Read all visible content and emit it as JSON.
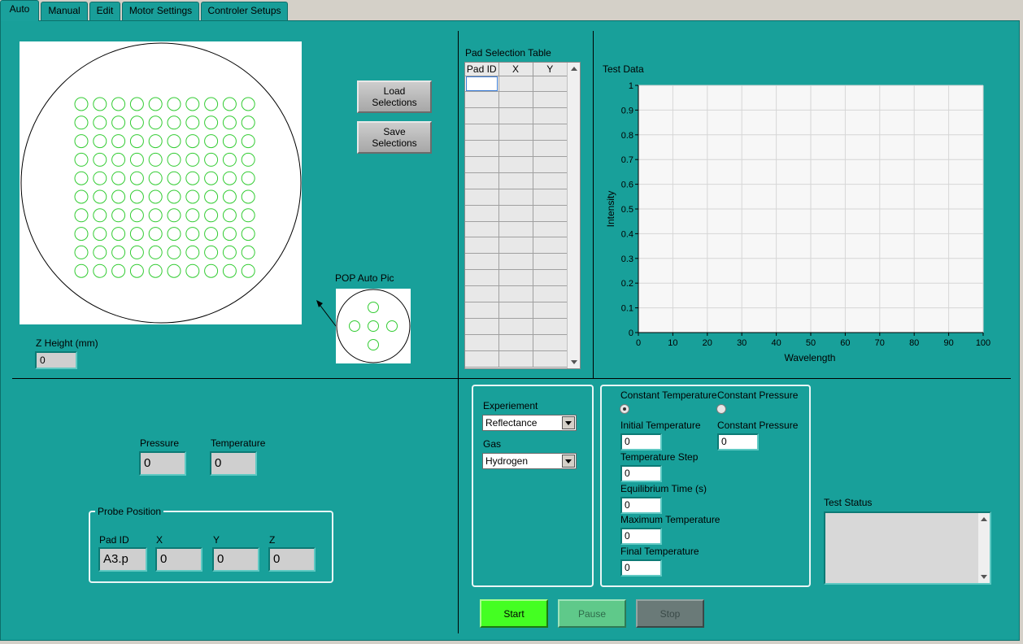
{
  "tabs": [
    "Auto",
    "Manual",
    "Edit",
    "Motor Settings",
    "Controler Setups"
  ],
  "active_tab": "Auto",
  "wafer": {
    "rows": 10,
    "cols": 10,
    "circle_color": "#33cc33"
  },
  "buttons": {
    "load": "Load\nSelections",
    "save": "Save\nSelections",
    "start": "Start",
    "pause": "Pause",
    "stop": "Stop"
  },
  "pop_auto_pic": {
    "label": "POP Auto Pic"
  },
  "z_height": {
    "label": "Z Height (mm)",
    "value": "0"
  },
  "pad_table": {
    "label": "Pad Selection Table",
    "headers": [
      "Pad ID",
      "X",
      "Y"
    ],
    "row_count": 18
  },
  "test_data_chart": {
    "label": "Test Data"
  },
  "chart_data": {
    "type": "line",
    "title": "Test Data",
    "xlabel": "Wavelength",
    "ylabel": "Intensity",
    "xlim": [
      0,
      100
    ],
    "ylim": [
      0,
      1
    ],
    "x_ticks": [
      "0",
      "10",
      "20",
      "30",
      "40",
      "50",
      "60",
      "70",
      "80",
      "90",
      "100"
    ],
    "y_ticks": [
      "0",
      "0.1",
      "0.2",
      "0.3",
      "0.4",
      "0.5",
      "0.6",
      "0.7",
      "0.8",
      "0.9",
      "1"
    ],
    "grid": true,
    "series": []
  },
  "pressure": {
    "label": "Pressure",
    "value": "0"
  },
  "temperature": {
    "label": "Temperature",
    "value": "0"
  },
  "probe_position": {
    "label": "Probe Position",
    "pad_id_label": "Pad ID",
    "pad_id": "A3.p",
    "x_label": "X",
    "x": "0",
    "y_label": "Y",
    "y": "0",
    "z_label": "Z",
    "z": "0"
  },
  "experiment": {
    "experiment_label": "Experiement",
    "experiment_value": "Reflectance",
    "gas_label": "Gas",
    "gas_value": "Hydrogen"
  },
  "mode": {
    "constant_temperature": "Constant Temperature",
    "constant_pressure": "Constant Pressure",
    "selected": "Constant Temperature",
    "initial_temperature_label": "Initial Temperature",
    "initial_temperature": "0",
    "constant_pressure_label": "Constant Pressure",
    "constant_pressure_value": "0",
    "temperature_step_label": "Temperature Step",
    "temperature_step": "0",
    "equilibrium_time_label": "Equilibrium Time (s)",
    "equilibrium_time": "0",
    "maximum_temperature_label": "Maximum Temperature",
    "maximum_temperature": "0",
    "final_temperature_label": "Final Temperature",
    "final_temperature": "0"
  },
  "test_status": {
    "label": "Test Status",
    "value": ""
  },
  "colors": {
    "panel": "#18a09a",
    "start": "#44ff22",
    "pause": "#5fc98a",
    "stop": "#6a7a78"
  }
}
